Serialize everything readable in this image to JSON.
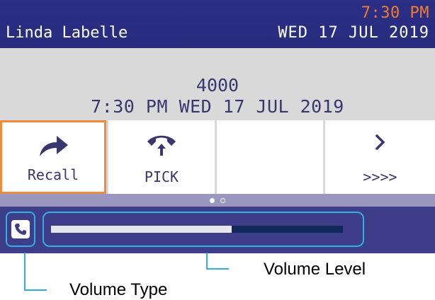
{
  "header": {
    "time": "7:30 PM",
    "user": "Linda Labelle",
    "date": "WED 17 JUL 2019"
  },
  "info": {
    "number": "4000",
    "datetime": "7:30 PM WED 17 JUL 2019"
  },
  "softkeys": [
    {
      "label": "Recall",
      "icon": "forward-arrow-icon",
      "selected": true
    },
    {
      "label": "PICK",
      "icon": "pickup-handset-icon",
      "selected": false
    },
    {
      "label": "",
      "icon": "",
      "selected": false
    },
    {
      "label": ">>>>",
      "icon": "chevron-right-icon",
      "selected": false
    }
  ],
  "pager": {
    "pages": 2,
    "current": 1
  },
  "volume": {
    "type_icon": "phone-handset-icon",
    "level_fraction": 0.62
  },
  "annotations": {
    "volume_level": "Volume Level",
    "volume_type": "Volume Type"
  },
  "colors": {
    "header_bg": "#2b2f86",
    "time": "#f07b2e",
    "selected_border": "#f08a3a",
    "highlight": "#2fb0e0",
    "volbar_bg": "#3e3d8a"
  }
}
